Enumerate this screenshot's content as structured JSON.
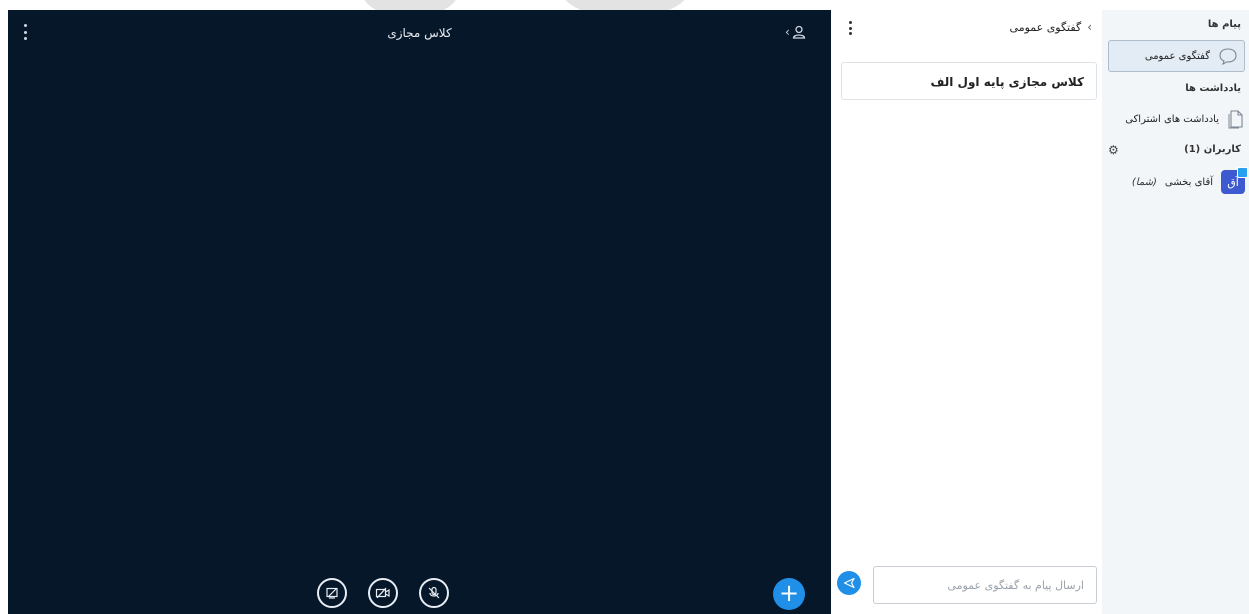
{
  "main": {
    "title": "کلاس مجازی",
    "controls": [
      {
        "icon": "screen-share-off-icon"
      },
      {
        "icon": "camera-off-icon"
      },
      {
        "icon": "microphone-off-icon"
      }
    ],
    "plus_label": "+"
  },
  "chat": {
    "header_title": "گفتگوی عمومی",
    "welcome_message": "کلاس مجازی پایه اول الف",
    "input_placeholder": "ارسال پیام به گفتگوی عمومی"
  },
  "sidebar": {
    "messages_heading": "پیام ها",
    "public_chat_label": "گفتگوی عمومی",
    "notes_heading": "یادداشت ها",
    "shared_notes_label": "یادداشت های اشتراکی",
    "users_heading": "کاربران (1)",
    "user": {
      "avatar_initial": "آق",
      "name": "آقای بخشی",
      "you_suffix": "(شما)"
    }
  },
  "colors": {
    "main_bg": "#06172a",
    "accent": "#1f8fe8",
    "avatar": "#3e5ad1",
    "sidebar_bg": "#f3f6f9"
  }
}
